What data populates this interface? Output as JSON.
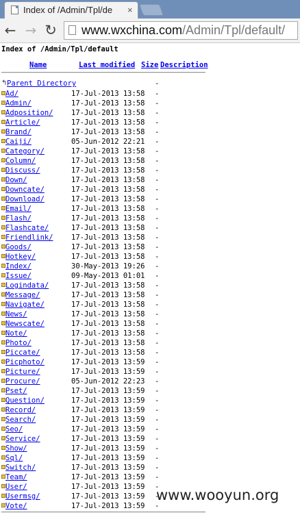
{
  "browser": {
    "tab_title": "Index of /Admin/Tpl/de",
    "tab_close": "×",
    "url_host": "www.wxchina.com",
    "url_path": "/Admin/Tpl/default/",
    "back_icon": "←",
    "forward_icon": "→",
    "reload_icon": "↻"
  },
  "page": {
    "heading": "Index of /Admin/Tpl/default",
    "columns": {
      "name": "Name",
      "last_modified": "Last modified",
      "size": "Size",
      "description": "Description"
    },
    "parent_label": "Parent Directory",
    "parent_size": "-",
    "entries": [
      {
        "name": "Ad/",
        "modified": "17-Jul-2013 13:58",
        "size": "-"
      },
      {
        "name": "Admin/",
        "modified": "17-Jul-2013 13:58",
        "size": "-"
      },
      {
        "name": "Adposition/",
        "modified": "17-Jul-2013 13:58",
        "size": "-"
      },
      {
        "name": "Article/",
        "modified": "17-Jul-2013 13:58",
        "size": "-"
      },
      {
        "name": "Brand/",
        "modified": "17-Jul-2013 13:58",
        "size": "-"
      },
      {
        "name": "Caiji/",
        "modified": "05-Jun-2012 22:21",
        "size": "-"
      },
      {
        "name": "Category/",
        "modified": "17-Jul-2013 13:58",
        "size": "-"
      },
      {
        "name": "Column/",
        "modified": "17-Jul-2013 13:58",
        "size": "-"
      },
      {
        "name": "Discuss/",
        "modified": "17-Jul-2013 13:58",
        "size": "-"
      },
      {
        "name": "Down/",
        "modified": "17-Jul-2013 13:58",
        "size": "-"
      },
      {
        "name": "Downcate/",
        "modified": "17-Jul-2013 13:58",
        "size": "-"
      },
      {
        "name": "Download/",
        "modified": "17-Jul-2013 13:58",
        "size": "-"
      },
      {
        "name": "Email/",
        "modified": "17-Jul-2013 13:58",
        "size": "-"
      },
      {
        "name": "Flash/",
        "modified": "17-Jul-2013 13:58",
        "size": "-"
      },
      {
        "name": "Flashcate/",
        "modified": "17-Jul-2013 13:58",
        "size": "-"
      },
      {
        "name": "Friendlink/",
        "modified": "17-Jul-2013 13:58",
        "size": "-"
      },
      {
        "name": "Goods/",
        "modified": "17-Jul-2013 13:58",
        "size": "-"
      },
      {
        "name": "Hotkey/",
        "modified": "17-Jul-2013 13:58",
        "size": "-"
      },
      {
        "name": "Index/",
        "modified": "30-May-2013 19:26",
        "size": "-"
      },
      {
        "name": "Issue/",
        "modified": "09-May-2013 01:01",
        "size": "-"
      },
      {
        "name": "Logindata/",
        "modified": "17-Jul-2013 13:58",
        "size": "-"
      },
      {
        "name": "Message/",
        "modified": "17-Jul-2013 13:58",
        "size": "-"
      },
      {
        "name": "Navigate/",
        "modified": "17-Jul-2013 13:58",
        "size": "-"
      },
      {
        "name": "News/",
        "modified": "17-Jul-2013 13:58",
        "size": "-"
      },
      {
        "name": "Newscate/",
        "modified": "17-Jul-2013 13:58",
        "size": "-"
      },
      {
        "name": "Note/",
        "modified": "17-Jul-2013 13:58",
        "size": "-"
      },
      {
        "name": "Photo/",
        "modified": "17-Jul-2013 13:58",
        "size": "-"
      },
      {
        "name": "Piccate/",
        "modified": "17-Jul-2013 13:58",
        "size": "-"
      },
      {
        "name": "Picphoto/",
        "modified": "17-Jul-2013 13:59",
        "size": "-"
      },
      {
        "name": "Picture/",
        "modified": "17-Jul-2013 13:59",
        "size": "-"
      },
      {
        "name": "Procure/",
        "modified": "05-Jun-2012 22:23",
        "size": "-"
      },
      {
        "name": "Pset/",
        "modified": "17-Jul-2013 13:59",
        "size": "-"
      },
      {
        "name": "Question/",
        "modified": "17-Jul-2013 13:59",
        "size": "-"
      },
      {
        "name": "Record/",
        "modified": "17-Jul-2013 13:59",
        "size": "-"
      },
      {
        "name": "Search/",
        "modified": "17-Jul-2013 13:59",
        "size": "-"
      },
      {
        "name": "Seo/",
        "modified": "17-Jul-2013 13:59",
        "size": "-"
      },
      {
        "name": "Service/",
        "modified": "17-Jul-2013 13:59",
        "size": "-"
      },
      {
        "name": "Show/",
        "modified": "17-Jul-2013 13:59",
        "size": "-"
      },
      {
        "name": "Sql/",
        "modified": "17-Jul-2013 13:59",
        "size": "-"
      },
      {
        "name": "Switch/",
        "modified": "17-Jul-2013 13:59",
        "size": "-"
      },
      {
        "name": "Team/",
        "modified": "17-Jul-2013 13:59",
        "size": "-"
      },
      {
        "name": "User/",
        "modified": "17-Jul-2013 13:59",
        "size": "-"
      },
      {
        "name": "Usermsg/",
        "modified": "17-Jul-2013 13:59",
        "size": "-"
      },
      {
        "name": "Vote/",
        "modified": "17-Jul-2013 13:59",
        "size": "-"
      }
    ]
  },
  "watermark": "www.wooyun.org"
}
